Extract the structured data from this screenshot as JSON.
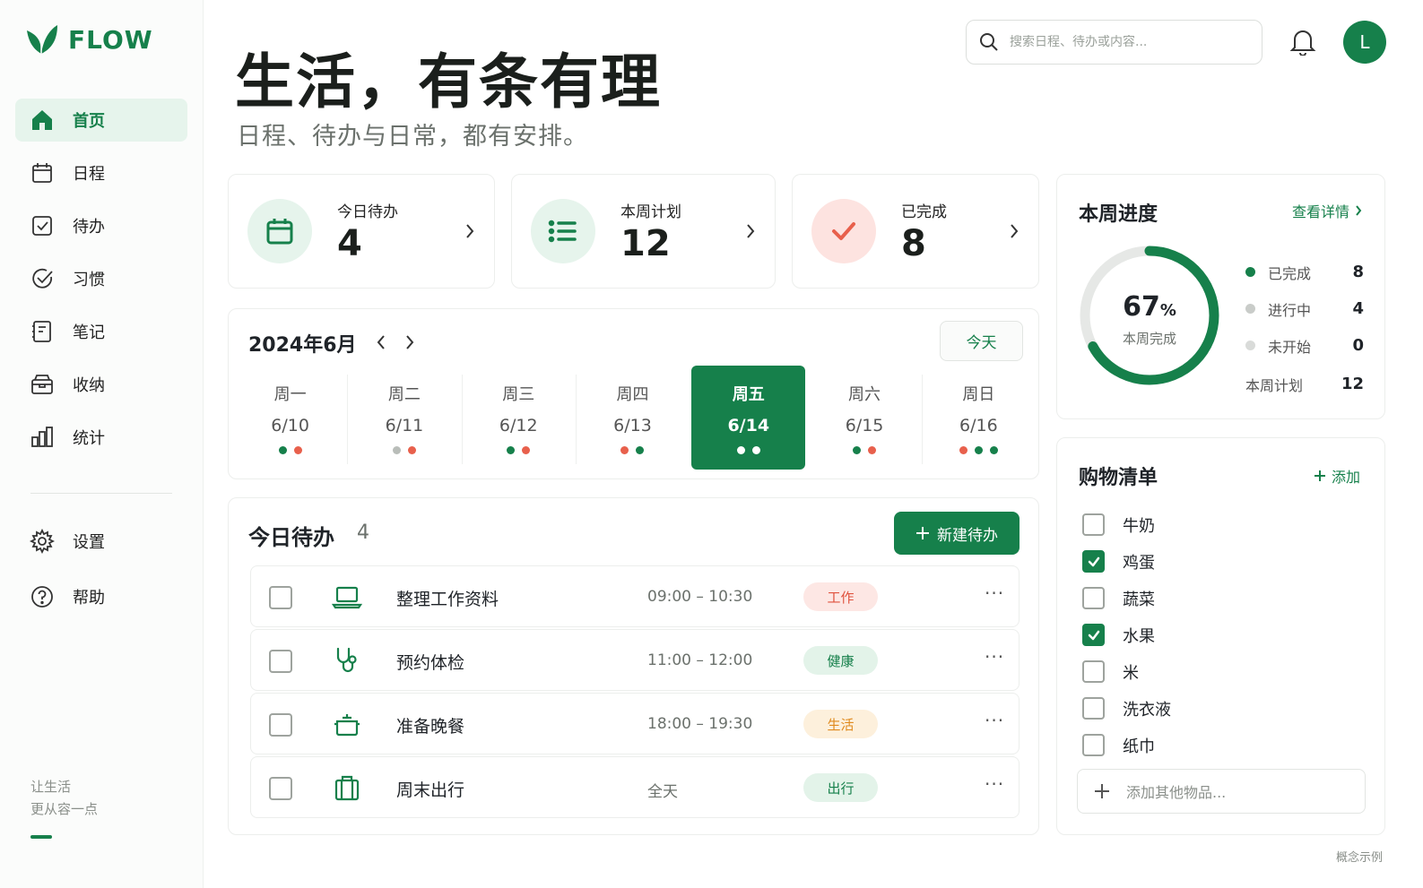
{
  "app": {
    "name": "FLOW",
    "accent": "#16804b"
  },
  "sidebar": {
    "items": [
      {
        "label": "首页",
        "icon": "home-icon",
        "active": true
      },
      {
        "label": "日程",
        "icon": "calendar-icon"
      },
      {
        "label": "待办",
        "icon": "checkbox-icon"
      },
      {
        "label": "习惯",
        "icon": "habit-check-icon"
      },
      {
        "label": "笔记",
        "icon": "notebook-icon"
      },
      {
        "label": "收纳",
        "icon": "storage-box-icon"
      },
      {
        "label": "统计",
        "icon": "bar-chart-icon"
      }
    ],
    "bottom_items": [
      {
        "label": "设置",
        "icon": "gear-icon"
      },
      {
        "label": "帮助",
        "icon": "help-icon"
      }
    ],
    "tagline_line1": "让生活",
    "tagline_line2": "更从容一点"
  },
  "header": {
    "title": "生活，有条有理",
    "subtitle": "日程、待办与日常，都有安排。",
    "search_placeholder": "搜索日程、待办或内容...",
    "avatar_initial": "L"
  },
  "stats": [
    {
      "label": "今日待办",
      "value": "4",
      "icon": "calendar-icon",
      "bg": "#e6f4ec",
      "color": "#16804b"
    },
    {
      "label": "本周计划",
      "value": "12",
      "icon": "list-icon",
      "bg": "#e6f4ec",
      "color": "#16804b"
    },
    {
      "label": "已完成",
      "value": "8",
      "icon": "checkmark-icon",
      "bg": "#fde3e0",
      "color": "#e8604c"
    }
  ],
  "calendar": {
    "month": "2024年6月",
    "today_label": "今天",
    "days": [
      {
        "name": "周一",
        "date": "6/10",
        "dots": [
          "#16804b",
          "#e8604c"
        ]
      },
      {
        "name": "周二",
        "date": "6/11",
        "dots": [
          "#b9bdb9",
          "#e8604c"
        ]
      },
      {
        "name": "周三",
        "date": "6/12",
        "dots": [
          "#16804b",
          "#e8604c"
        ]
      },
      {
        "name": "周四",
        "date": "6/13",
        "dots": [
          "#e8604c",
          "#16804b"
        ]
      },
      {
        "name": "周五",
        "date": "6/14",
        "dots": [
          "#ffffff",
          "#ffffff"
        ],
        "selected": true
      },
      {
        "name": "周六",
        "date": "6/15",
        "dots": [
          "#16804b",
          "#e8604c"
        ]
      },
      {
        "name": "周日",
        "date": "6/16",
        "dots": [
          "#e8604c",
          "#16804b",
          "#16804b"
        ]
      }
    ]
  },
  "todo": {
    "title": "今日待办",
    "count": "4",
    "new_label": "新建待办",
    "rows": [
      {
        "title": "整理工作资料",
        "time": "09:00 – 10:30",
        "tag": "工作",
        "tag_bg": "#fde7e4",
        "tag_color": "#e0533f",
        "icon": "laptop-icon"
      },
      {
        "title": "预约体检",
        "time": "11:00 – 12:00",
        "tag": "健康",
        "tag_bg": "#e3f3e9",
        "tag_color": "#16804b",
        "icon": "stethoscope-icon"
      },
      {
        "title": "准备晚餐",
        "time": "18:00 – 19:30",
        "tag": "生活",
        "tag_bg": "#fdf0dc",
        "tag_color": "#e08a1e",
        "icon": "cooking-pot-icon"
      },
      {
        "title": "周末出行",
        "time": "全天",
        "tag": "出行",
        "tag_bg": "#e3f3e9",
        "tag_color": "#16804b",
        "icon": "suitcase-icon"
      }
    ]
  },
  "progress": {
    "title": "本周进度",
    "link": "查看详情",
    "percent": "67",
    "percent_unit": "%",
    "percent_value": 0.67,
    "ring_label": "本周完成",
    "legend": [
      {
        "label": "已完成",
        "value": "8",
        "color": "#16804b"
      },
      {
        "label": "进行中",
        "value": "4",
        "color": "#c9ccc9"
      },
      {
        "label": "未开始",
        "value": "0",
        "color": "#d9dbd9"
      }
    ],
    "total_label": "本周计划",
    "total_value": "12"
  },
  "shopping": {
    "title": "购物清单",
    "add_label": "添加",
    "items": [
      {
        "label": "牛奶",
        "checked": false
      },
      {
        "label": "鸡蛋",
        "checked": true
      },
      {
        "label": "蔬菜",
        "checked": false
      },
      {
        "label": "水果",
        "checked": true
      },
      {
        "label": "米",
        "checked": false
      },
      {
        "label": "洗衣液",
        "checked": false
      },
      {
        "label": "纸巾",
        "checked": false
      }
    ],
    "add_more_placeholder": "添加其他物品..."
  },
  "footer": {
    "note": "概念示例"
  }
}
